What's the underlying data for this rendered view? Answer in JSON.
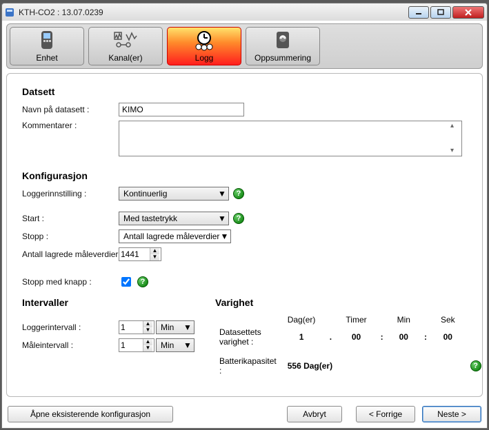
{
  "window": {
    "title": "KTH-CO2 : 13.07.0239"
  },
  "tabs": [
    {
      "label": "Enhet"
    },
    {
      "label": "Kanal(er)"
    },
    {
      "label": "Logg"
    },
    {
      "label": "Oppsummering"
    }
  ],
  "section_datset": {
    "title": "Datsett",
    "name_label": "Navn på datasett :",
    "name_value": "KIMO",
    "comment_label": "Kommentarer :",
    "comment_value": ""
  },
  "section_config": {
    "title": "Konfigurasjon",
    "logger_setting_label": "Loggerinnstilling :",
    "logger_setting_value": "Kontinuerlig",
    "start_label": "Start :",
    "start_value": "Med tastetrykk",
    "stop_label": "Stopp :",
    "stop_value": "Antall lagrede måleverdier",
    "count_label": "Antall lagrede måleverdier",
    "count_value": "1441",
    "stop_button_label": "Stopp med knapp :",
    "stop_button_checked": true
  },
  "section_intervals": {
    "title": "Intervaller",
    "log_interval_label": "Loggerintervall :",
    "log_interval_value": "1",
    "log_interval_unit": "Min",
    "meas_interval_label": "Måleintervall :",
    "meas_interval_value": "1",
    "meas_interval_unit": "Min"
  },
  "section_duration": {
    "title": "Varighet",
    "hdr_days": "Dag(er)",
    "hdr_hours": "Timer",
    "hdr_min": "Min",
    "hdr_sec": "Sek",
    "dataset_label": "Datasettets varighet :",
    "dataset_days": "1",
    "dataset_hours": "00",
    "dataset_min": "00",
    "dataset_sec": "00",
    "sep_dot": ".",
    "sep_colon": ":",
    "battery_label": "Batterikapasitet :",
    "battery_value": "556 Dag(er)"
  },
  "buttons": {
    "open_config": "Åpne eksisterende konfigurasjon",
    "cancel": "Avbryt",
    "back": "< Forrige",
    "next": "Neste >"
  }
}
